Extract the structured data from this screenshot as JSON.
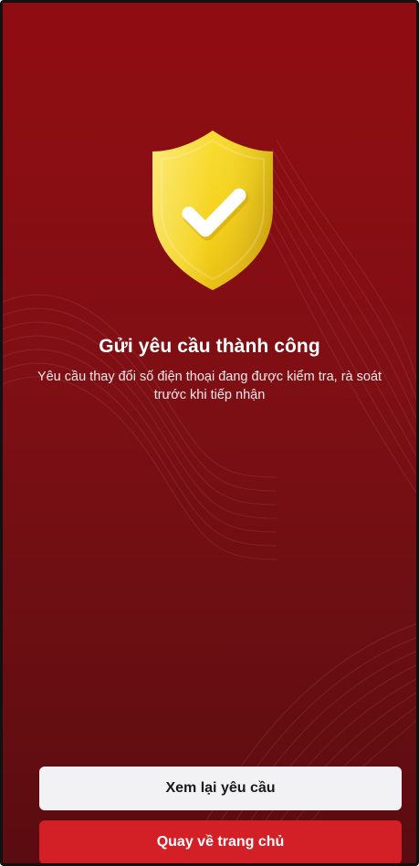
{
  "success": {
    "title": "Gửi yêu cầu thành công",
    "message_line1": "Yêu cầu thay đổi số điện thoại đang được kiểm tra, rà soát",
    "message_line2": "trước khi tiếp nhận",
    "icon": "shield-check-icon"
  },
  "actions": {
    "review_label": "Xem lại yêu cầu",
    "home_label": "Quay về trang chủ"
  },
  "colors": {
    "background_top": "#8f0c12",
    "background_bottom": "#5a0c10",
    "shield": "#f5d21a",
    "primary_button": "#d32027",
    "secondary_button": "#f2f2f4"
  }
}
